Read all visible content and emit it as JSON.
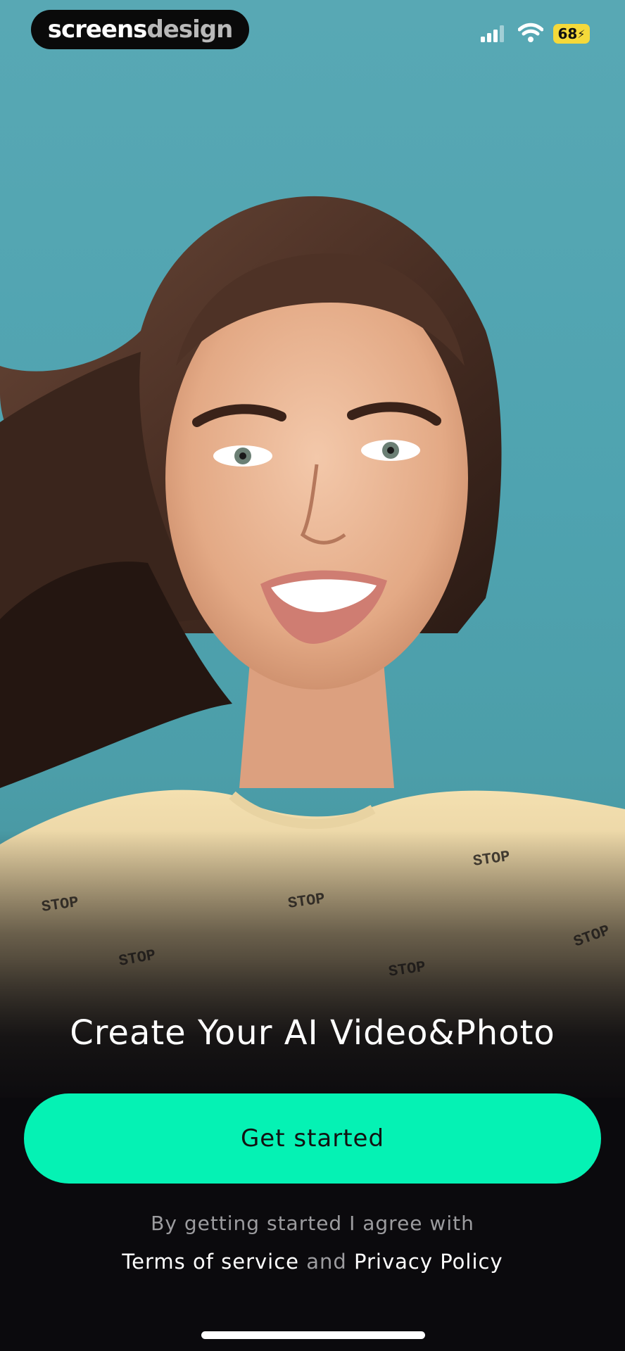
{
  "status_bar": {
    "brand_part1": "screens",
    "brand_part2": "design",
    "battery_level": "68",
    "icons": [
      "signal-icon",
      "wifi-icon",
      "battery-charging-icon"
    ]
  },
  "hero": {
    "image_subject": "smiling woman with long brown hair on teal background",
    "shirt_prints": [
      "STOP",
      "STOP",
      "STOP",
      "STOP",
      "STOP",
      "STOP"
    ]
  },
  "onboarding": {
    "headline": "Create Your AI Video&Photo",
    "cta_label": "Get started",
    "legal_line1": "By getting started I agree with",
    "terms_link": "Terms of service",
    "legal_and": "and",
    "privacy_link": "Privacy Policy"
  },
  "colors": {
    "accent": "#05F2B4",
    "background": "#0B0A0D",
    "hero_bg": "#4FA3B0",
    "battery": "#F5D93A"
  }
}
